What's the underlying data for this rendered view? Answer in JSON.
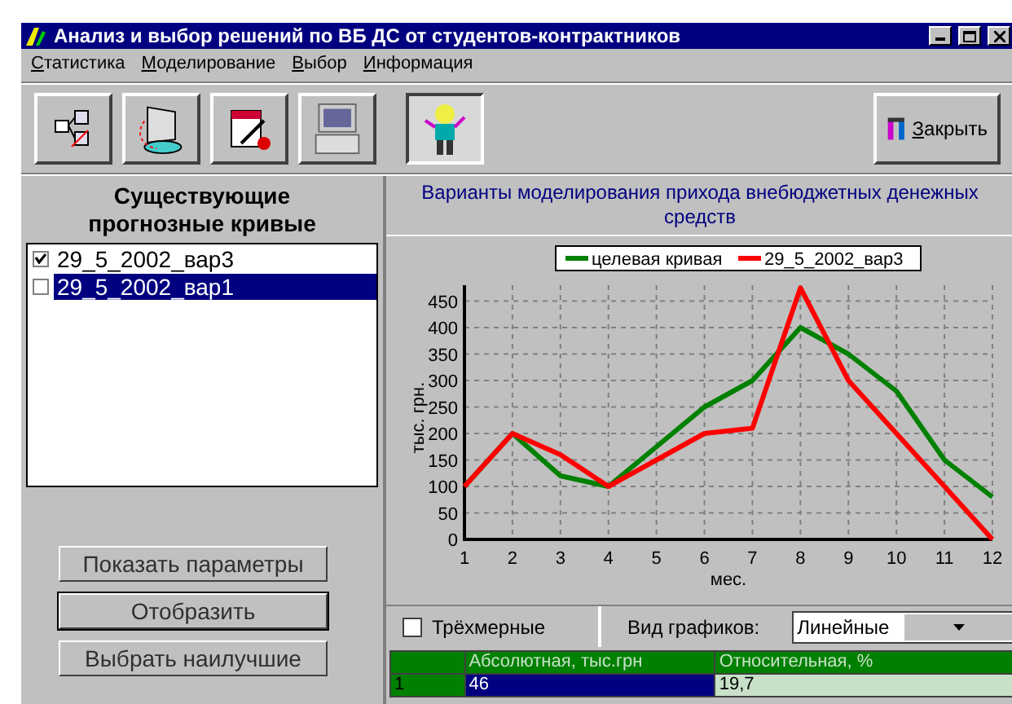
{
  "window": {
    "title": "Анализ и выбор решений по ВБ ДС от студентов-контрактников"
  },
  "menu": [
    "Статистика",
    "Моделирование",
    "Выбор",
    "Информация"
  ],
  "toolbar": {
    "buttons": [
      {
        "selected": false
      },
      {
        "selected": false
      },
      {
        "selected": false
      },
      {
        "selected": false
      },
      {
        "selected": true
      }
    ],
    "close_button": "Закрыть"
  },
  "left_panel": {
    "heading": "Существующие прогнозные кривые",
    "items": [
      {
        "label": "29_5_2002_вар3",
        "checked": true,
        "selected": false
      },
      {
        "label": "29_5_2002_вар1",
        "checked": false,
        "selected": true
      }
    ],
    "buttons": [
      "Показать параметры",
      "Отобразить",
      "Выбрать наилучшие"
    ]
  },
  "chart_panel": {
    "title": "Варианты моделирования прихода внебюджетных денежных средств",
    "chart_data": {
      "type": "line",
      "xlabel": "мес.",
      "ylabel": "тыс. грн.",
      "x": [
        1,
        2,
        3,
        4,
        5,
        6,
        7,
        8,
        9,
        10,
        11,
        12
      ],
      "series": [
        {
          "name": "целевая кривая",
          "color": "#008000",
          "values": [
            100,
            200,
            120,
            100,
            175,
            250,
            300,
            400,
            350,
            280,
            150,
            80
          ]
        },
        {
          "name": "29_5_2002_вар3",
          "color": "#ff0000",
          "values": [
            100,
            200,
            160,
            100,
            150,
            200,
            210,
            475,
            300,
            200,
            100,
            0
          ]
        }
      ],
      "xlim": [
        1,
        12
      ],
      "ylim": [
        0,
        480
      ],
      "grid": true,
      "legend": true,
      "xticks": [
        1,
        2,
        3,
        4,
        5,
        6,
        7,
        8,
        9,
        10,
        11,
        12
      ],
      "yticks": [
        0,
        50,
        100,
        150,
        200,
        250,
        300,
        350,
        400,
        450
      ]
    },
    "three_d": {
      "label": "Трёхмерные",
      "checked": false
    },
    "chart_type": {
      "label": "Вид графиков:",
      "value": "Линейные"
    }
  },
  "table": {
    "columns": [
      "Абсолютная, тыс.грн",
      "Относительная, %"
    ],
    "rows": [
      {
        "label": "1",
        "cells": [
          {
            "text": "46",
            "selected": true
          },
          {
            "text": "19,7",
            "selected": false
          }
        ]
      }
    ]
  }
}
